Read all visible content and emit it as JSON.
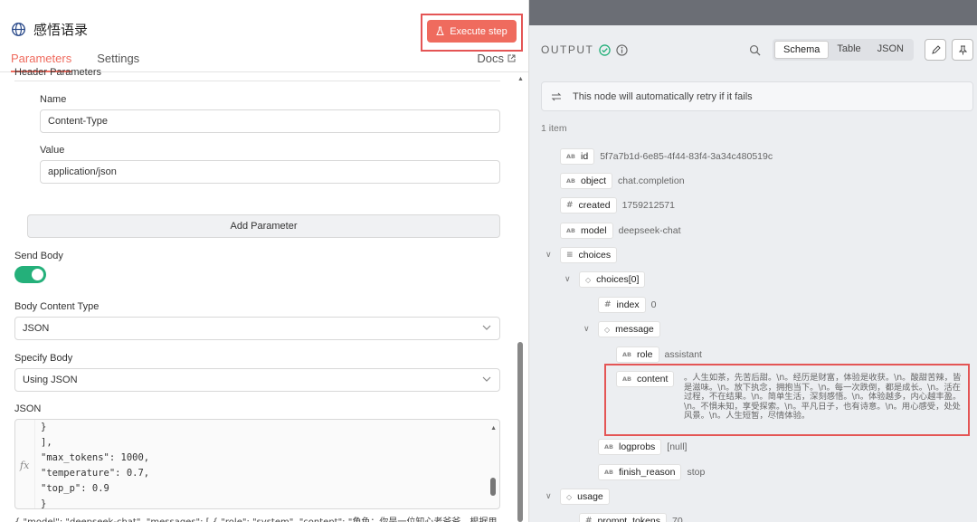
{
  "node": {
    "title": "感悟语录",
    "execute_label": "Execute step"
  },
  "tabs": {
    "parameters": "Parameters",
    "settings": "Settings",
    "docs": "Docs"
  },
  "form": {
    "header_section_label": "Header Parameters",
    "name_label": "Name",
    "name_value": "Content-Type",
    "value_label": "Value",
    "value_value": "application/json",
    "add_param": "Add Parameter",
    "send_body_label": "Send Body",
    "send_body_on": true,
    "body_content_type_label": "Body Content Type",
    "body_content_type_value": "JSON",
    "specify_body_label": "Specify Body",
    "specify_body_value": "Using JSON",
    "json_label": "JSON",
    "json_lines": [
      "}",
      "],",
      "\"max_tokens\": 1000,",
      "\"temperature\": 0.7,",
      "\"top_p\": 0.9",
      "}"
    ],
    "preview": "{ \"model\": \"deepseek-chat\", \"messages\": [ { \"role\": \"system\", \"content\": \"角色：你是一位知心老爷爷，根据用..."
  },
  "output": {
    "title": "OUTPUT",
    "views": [
      "Schema",
      "Table",
      "JSON"
    ],
    "active_view": "Schema",
    "notice": "This node will automatically retry if it fails",
    "item_count": "1 item",
    "fields": {
      "id": {
        "key": "id",
        "value": "5f7a7b1d-6e85-4f44-83f4-3a34c480519c"
      },
      "object": {
        "key": "object",
        "value": "chat.completion"
      },
      "created": {
        "key": "created",
        "value": "1759212571"
      },
      "model": {
        "key": "model",
        "value": "deepseek-chat"
      },
      "choices": {
        "key": "choices"
      },
      "choices0": {
        "key": "choices[0]"
      },
      "index": {
        "key": "index",
        "value": "0"
      },
      "message": {
        "key": "message"
      },
      "role": {
        "key": "role",
        "value": "assistant"
      },
      "content": {
        "key": "content",
        "value": "。人生如茶，先苦后甜。\\n。经历是财富，体验是收获。\\n。酸甜苦辣，皆是滋味。\\n。放下执念，拥抱当下。\\n。每一次跌倒，都是成长。\\n。活在过程，不在结果。\\n。简单生活，深刻感悟。\\n。体验越多，内心越丰盈。\\n。不惧未知，享受探索。\\n。平凡日子，也有诗意。\\n。用心感受，处处风景。\\n。人生短暂，尽情体验。"
      },
      "logprobs": {
        "key": "logprobs",
        "value": "[null]"
      },
      "finish_reason": {
        "key": "finish_reason",
        "value": "stop"
      },
      "usage": {
        "key": "usage"
      },
      "prompt_tokens": {
        "key": "prompt_tokens",
        "value": "70"
      }
    }
  },
  "colors": {
    "accent": "#ef6b5e",
    "toggle_on": "#24b07a",
    "highlight": "#e45555"
  }
}
